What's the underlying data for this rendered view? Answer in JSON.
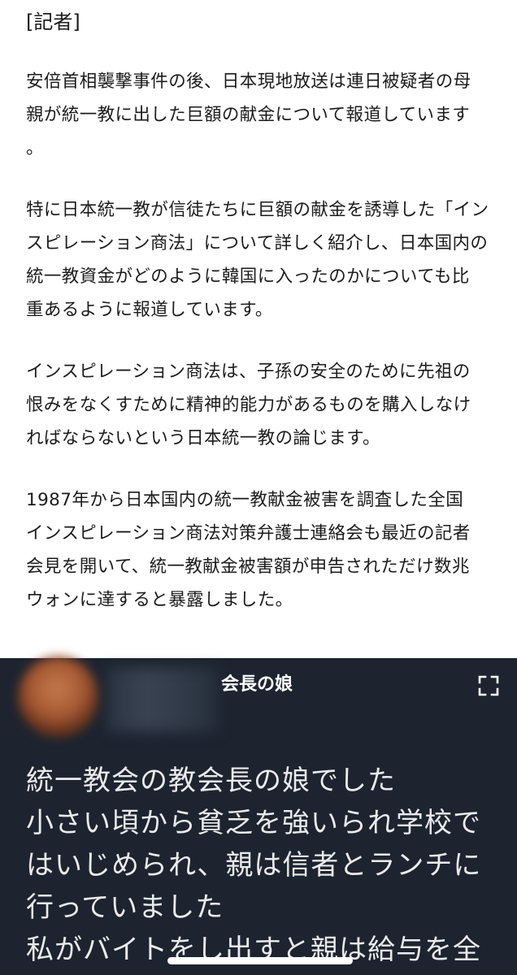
{
  "article": {
    "section_label": "[記者]",
    "paragraphs": [
      {
        "lines": [
          "安倍首相襲撃事件の後、日本現地放送は連日被疑者の母",
          "親が統一教に出した巨額の献金について報道しています",
          "。"
        ]
      },
      {
        "lines": [
          "特に日本統一教が信徒たちに巨額の献金を誘導した「イン",
          "スピレーション商法」について詳しく紹介し、日本国内の",
          "統一教資金がどのように韓国に入ったのかについても比",
          "重あるように報道しています。"
        ]
      },
      {
        "lines": [
          "インスピレーション商法は、子孫の安全のために先祖の",
          "恨みをなくすために精神的能力があるものを購入しなけ",
          "ればならないという日本統一教の論じます。"
        ]
      },
      {
        "lines": [
          "1987年から日本国内の統一教献金被害を調査した全国",
          "インスピレーション商法対策弁護士連絡会も最近の記者",
          "会見を開いて、統一教献金被害額が申告されただけ数兆",
          "ウォンに達すると暴露しました。"
        ]
      }
    ]
  },
  "video": {
    "title": "会長の娘",
    "fullscreen_icon": "fullscreen-icon",
    "caption_lines": [
      "統一教会の教会長の娘でした",
      "小さい頃から貧乏を強いられ学校で",
      "はいじめられ、親は信者とランチに",
      "行っていました",
      "私がバイトをし出すと親は給与を全"
    ]
  },
  "colors": {
    "article_text": "#1b1b1b",
    "video_background": "#1d2430",
    "caption_text": "#ebebeb"
  }
}
